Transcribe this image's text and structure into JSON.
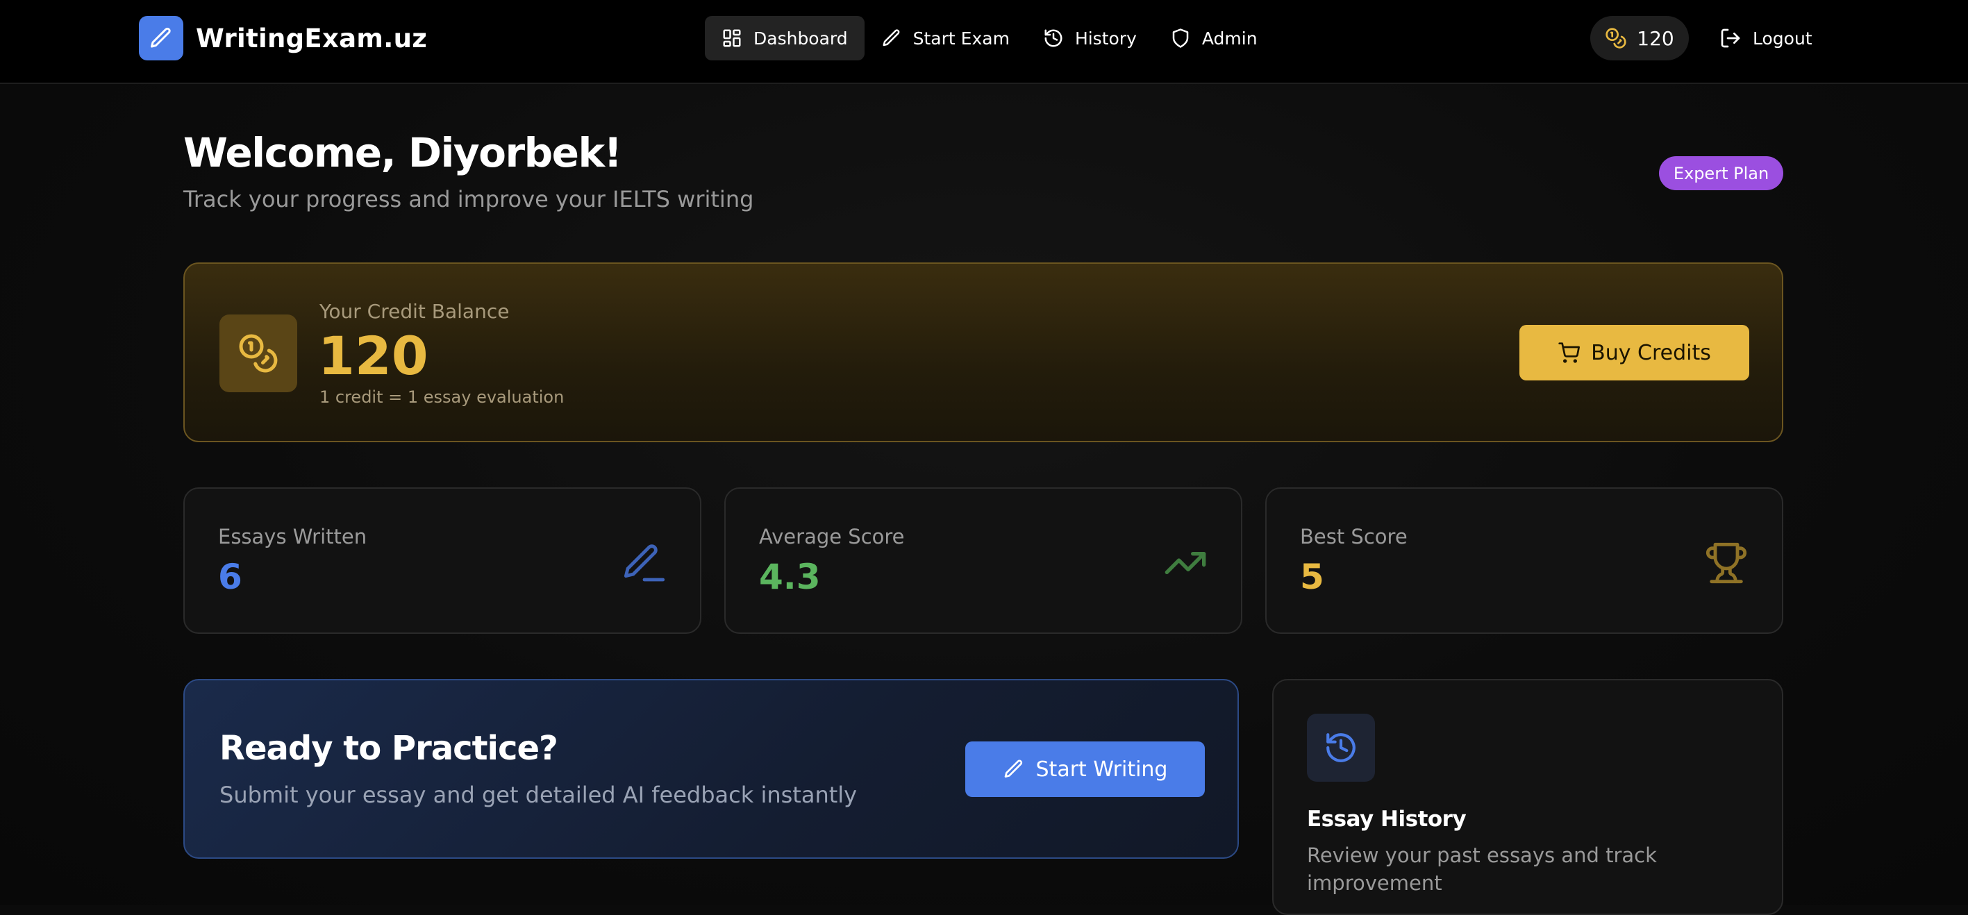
{
  "app": {
    "brand_name": "WritingExam.uz",
    "colors": {
      "accent_blue": "#4a7ce8",
      "accent_gold": "#e8b941",
      "accent_green": "#5bb55e",
      "accent_purple": "#9b4fe0"
    }
  },
  "nav": {
    "items": [
      {
        "label": "Dashboard",
        "icon": "dashboard-icon",
        "active": true
      },
      {
        "label": "Start Exam",
        "icon": "pencil-icon",
        "active": false
      },
      {
        "label": "History",
        "icon": "history-icon",
        "active": false
      },
      {
        "label": "Admin",
        "icon": "shield-icon",
        "active": false
      }
    ],
    "credits": "120",
    "logout_label": "Logout"
  },
  "header": {
    "welcome": "Welcome, Diyorbek!",
    "subtitle": "Track your progress and improve your IELTS writing",
    "plan_badge": "Expert Plan"
  },
  "credit_card": {
    "label": "Your Credit Balance",
    "value": "120",
    "note": "1 credit = 1 essay evaluation",
    "buy_label": "Buy Credits"
  },
  "stats": [
    {
      "label": "Essays Written",
      "value": "6",
      "icon": "pen-icon",
      "color": "#4a7ce8"
    },
    {
      "label": "Average Score",
      "value": "4.3",
      "icon": "trending-up-icon",
      "color": "#5bb55e"
    },
    {
      "label": "Best Score",
      "value": "5",
      "icon": "trophy-icon",
      "color": "#e8b941"
    }
  ],
  "practice": {
    "title": "Ready to Practice?",
    "subtitle": "Submit your essay and get detailed AI feedback instantly",
    "button_label": "Start Writing"
  },
  "history_card": {
    "title": "Essay History",
    "subtitle": "Review your past essays and track improvement"
  }
}
